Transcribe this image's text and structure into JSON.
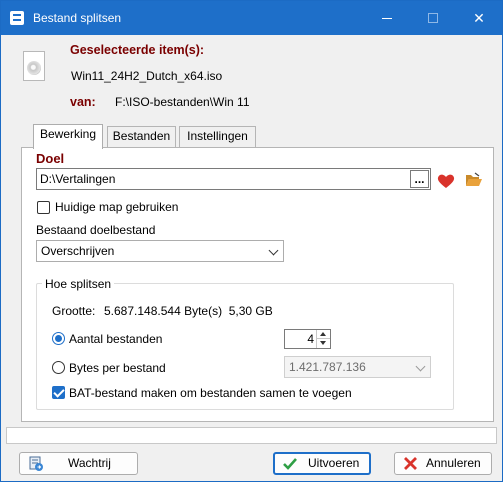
{
  "window": {
    "title": "Bestand splitsen",
    "controls": {
      "minimize": "—",
      "maximize": "☐",
      "close": "✕"
    }
  },
  "header": {
    "selected_items_label": "Geselecteerde item(s):",
    "selected_file": "Win11_24H2_Dutch_x64.iso",
    "from_label": "van:",
    "from_path": "F:\\ISO-bestanden\\Win 11"
  },
  "tabs": [
    {
      "label": "Bewerking",
      "active": true
    },
    {
      "label": "Bestanden",
      "active": false
    },
    {
      "label": "Instellingen",
      "active": false
    }
  ],
  "target": {
    "section_title": "Doel",
    "path_value": "D:\\Vertalingen",
    "browse_button": "...",
    "use_current_folder_label": "Huidige map gebruiken",
    "use_current_folder_checked": false
  },
  "existing_file": {
    "label": "Bestaand doelbestand",
    "selected": "Overschrijven"
  },
  "split": {
    "group_label": "Hoe splitsen",
    "size_label": "Grootte:",
    "size_value": "5.687.148.544 Byte(s)  5,30 GB",
    "count_option_label": "Aantal bestanden",
    "count_value": "4",
    "bytes_option_label": "Bytes per bestand",
    "bytes_value": "1.421.787.136",
    "selected_option": "count",
    "bat_label": "BAT-bestand maken om bestanden samen te voegen",
    "bat_checked": true
  },
  "buttons": {
    "queue": "Wachtrij",
    "execute": "Uitvoeren",
    "cancel": "Annuleren"
  },
  "colors": {
    "titlebar": "#1e6fc9",
    "section_label": "#7a0000",
    "heart": "#d9332b",
    "folder": "#e9a23b",
    "execute_check": "#2e9e44",
    "cancel_x": "#d9332b"
  }
}
